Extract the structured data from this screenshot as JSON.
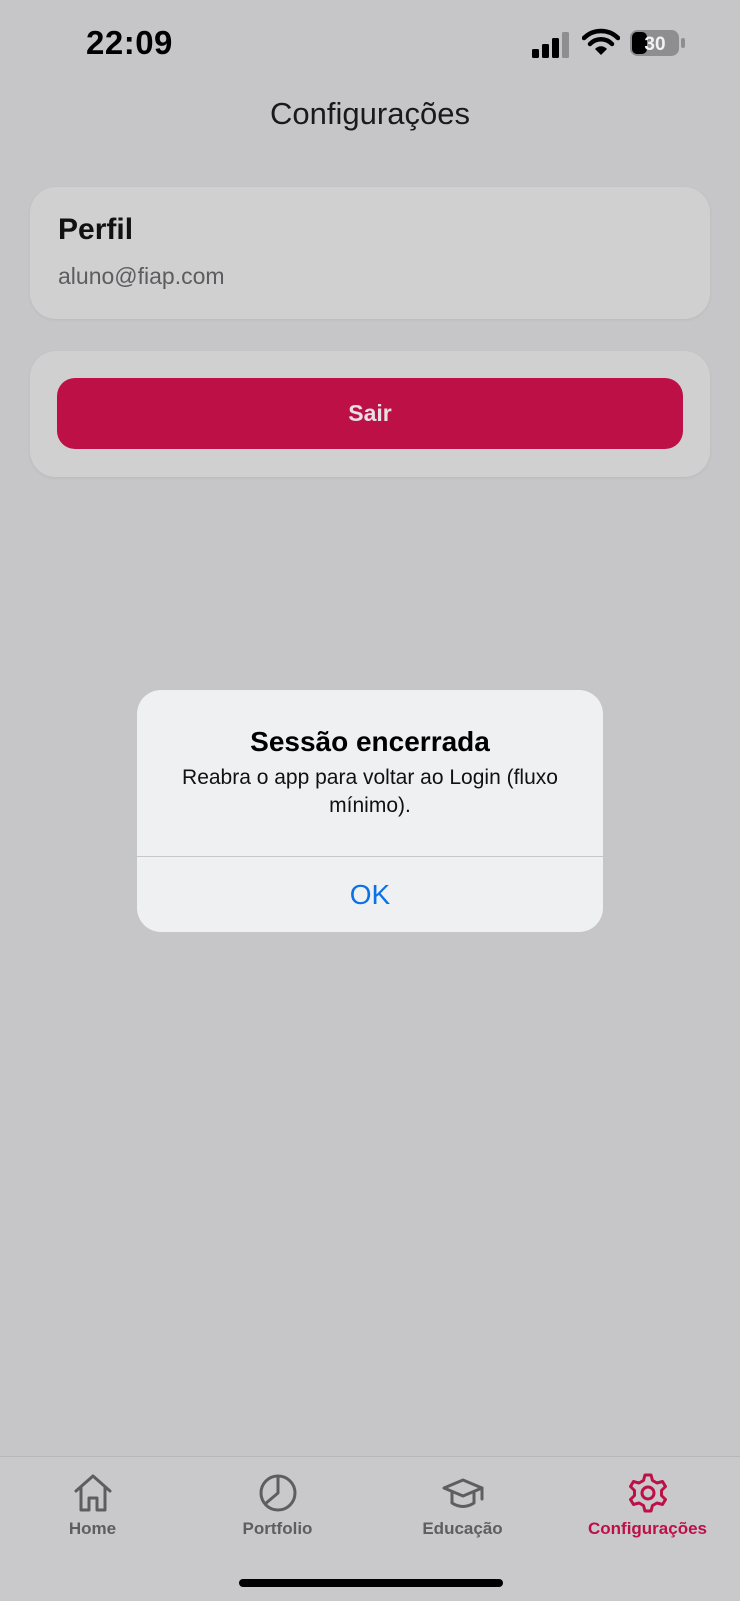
{
  "status_bar": {
    "time": "22:09",
    "battery_level": "30",
    "icons": [
      "signal-icon",
      "wifi-icon",
      "battery-icon"
    ]
  },
  "header": {
    "title": "Configurações"
  },
  "profile": {
    "title": "Perfil",
    "email": "aluno@fiap.com"
  },
  "logout": {
    "label": "Sair",
    "color": "#bd1047"
  },
  "alert": {
    "title": "Sessão encerrada",
    "message": "Reabra o app para voltar ao Login (fluxo mínimo).",
    "ok_label": "OK",
    "ok_color": "#0a72e6"
  },
  "tabs": [
    {
      "label": "Home",
      "icon": "home-icon",
      "active": false
    },
    {
      "label": "Portfolio",
      "icon": "pie-chart-icon",
      "active": false
    },
    {
      "label": "Educação",
      "icon": "graduation-cap-icon",
      "active": false
    },
    {
      "label": "Configurações",
      "icon": "gear-icon",
      "active": true
    }
  ],
  "colors": {
    "accent": "#bd1047",
    "background": "#c6c6c8",
    "inactive_tab": "#5e5e60"
  }
}
